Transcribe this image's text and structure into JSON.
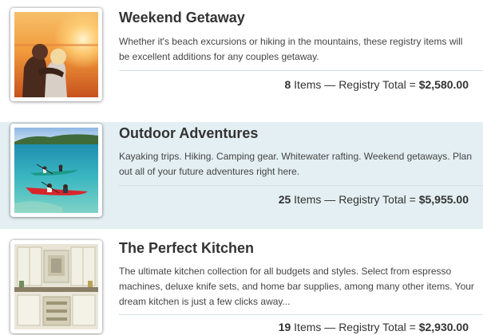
{
  "registries": [
    {
      "title": "Weekend Getaway",
      "description": "Whether it's beach excursions or hiking in the mountains, these registry items will be excellent additions for any couples getaway.",
      "item_count": "8",
      "items_word": "Items",
      "dash": "—",
      "total_label": "Registry Total =",
      "total": "$2,580.00",
      "image": "couple-sunset-photo"
    },
    {
      "title": "Outdoor Adventures",
      "description": "Kayaking trips. Hiking. Camping gear. Whitewater rafting. Weekend getaways. Plan out all of your future adventures right here.",
      "item_count": "25",
      "items_word": "Items",
      "dash": "—",
      "total_label": "Registry Total =",
      "total": "$5,955.00",
      "image": "kayaks-lake-photo"
    },
    {
      "title": "The Perfect Kitchen",
      "description": "The ultimate kitchen collection for all budgets and styles. Select from espresso machines, deluxe knife sets, and home bar supplies, among many other items. Your dream kitchen is just a few clicks away...",
      "item_count": "19",
      "items_word": "Items",
      "dash": "—",
      "total_label": "Registry Total =",
      "total": "$2,930.00",
      "image": "kitchen-photo"
    }
  ],
  "colors": {
    "alt_row_background": "#e3eff2",
    "title_text": "#333333",
    "divider": "#d3dfe2"
  }
}
